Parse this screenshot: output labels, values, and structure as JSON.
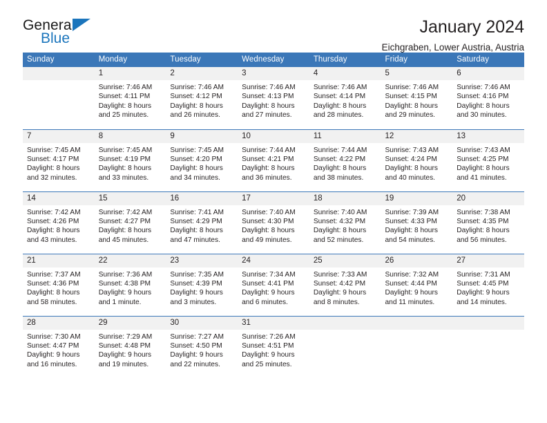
{
  "brand": {
    "name_top": "General",
    "name_bottom": "Blue",
    "accent_color": "#1b75bc"
  },
  "header": {
    "title": "January 2024",
    "subtitle": "Eichgraben, Lower Austria, Austria"
  },
  "theme": {
    "header_row_bg": "#3b77b8",
    "header_row_text": "#ffffff",
    "daynum_bg": "#f1f1f1",
    "separator": "#3b77b8",
    "body_text": "#231f20"
  },
  "weekdays": [
    "Sunday",
    "Monday",
    "Tuesday",
    "Wednesday",
    "Thursday",
    "Friday",
    "Saturday"
  ],
  "weeks": [
    [
      {
        "day": "",
        "lines": []
      },
      {
        "day": "1",
        "lines": [
          "Sunrise: 7:46 AM",
          "Sunset: 4:11 PM",
          "Daylight: 8 hours",
          "and 25 minutes."
        ]
      },
      {
        "day": "2",
        "lines": [
          "Sunrise: 7:46 AM",
          "Sunset: 4:12 PM",
          "Daylight: 8 hours",
          "and 26 minutes."
        ]
      },
      {
        "day": "3",
        "lines": [
          "Sunrise: 7:46 AM",
          "Sunset: 4:13 PM",
          "Daylight: 8 hours",
          "and 27 minutes."
        ]
      },
      {
        "day": "4",
        "lines": [
          "Sunrise: 7:46 AM",
          "Sunset: 4:14 PM",
          "Daylight: 8 hours",
          "and 28 minutes."
        ]
      },
      {
        "day": "5",
        "lines": [
          "Sunrise: 7:46 AM",
          "Sunset: 4:15 PM",
          "Daylight: 8 hours",
          "and 29 minutes."
        ]
      },
      {
        "day": "6",
        "lines": [
          "Sunrise: 7:46 AM",
          "Sunset: 4:16 PM",
          "Daylight: 8 hours",
          "and 30 minutes."
        ]
      }
    ],
    [
      {
        "day": "7",
        "lines": [
          "Sunrise: 7:45 AM",
          "Sunset: 4:17 PM",
          "Daylight: 8 hours",
          "and 32 minutes."
        ]
      },
      {
        "day": "8",
        "lines": [
          "Sunrise: 7:45 AM",
          "Sunset: 4:19 PM",
          "Daylight: 8 hours",
          "and 33 minutes."
        ]
      },
      {
        "day": "9",
        "lines": [
          "Sunrise: 7:45 AM",
          "Sunset: 4:20 PM",
          "Daylight: 8 hours",
          "and 34 minutes."
        ]
      },
      {
        "day": "10",
        "lines": [
          "Sunrise: 7:44 AM",
          "Sunset: 4:21 PM",
          "Daylight: 8 hours",
          "and 36 minutes."
        ]
      },
      {
        "day": "11",
        "lines": [
          "Sunrise: 7:44 AM",
          "Sunset: 4:22 PM",
          "Daylight: 8 hours",
          "and 38 minutes."
        ]
      },
      {
        "day": "12",
        "lines": [
          "Sunrise: 7:43 AM",
          "Sunset: 4:24 PM",
          "Daylight: 8 hours",
          "and 40 minutes."
        ]
      },
      {
        "day": "13",
        "lines": [
          "Sunrise: 7:43 AM",
          "Sunset: 4:25 PM",
          "Daylight: 8 hours",
          "and 41 minutes."
        ]
      }
    ],
    [
      {
        "day": "14",
        "lines": [
          "Sunrise: 7:42 AM",
          "Sunset: 4:26 PM",
          "Daylight: 8 hours",
          "and 43 minutes."
        ]
      },
      {
        "day": "15",
        "lines": [
          "Sunrise: 7:42 AM",
          "Sunset: 4:27 PM",
          "Daylight: 8 hours",
          "and 45 minutes."
        ]
      },
      {
        "day": "16",
        "lines": [
          "Sunrise: 7:41 AM",
          "Sunset: 4:29 PM",
          "Daylight: 8 hours",
          "and 47 minutes."
        ]
      },
      {
        "day": "17",
        "lines": [
          "Sunrise: 7:40 AM",
          "Sunset: 4:30 PM",
          "Daylight: 8 hours",
          "and 49 minutes."
        ]
      },
      {
        "day": "18",
        "lines": [
          "Sunrise: 7:40 AM",
          "Sunset: 4:32 PM",
          "Daylight: 8 hours",
          "and 52 minutes."
        ]
      },
      {
        "day": "19",
        "lines": [
          "Sunrise: 7:39 AM",
          "Sunset: 4:33 PM",
          "Daylight: 8 hours",
          "and 54 minutes."
        ]
      },
      {
        "day": "20",
        "lines": [
          "Sunrise: 7:38 AM",
          "Sunset: 4:35 PM",
          "Daylight: 8 hours",
          "and 56 minutes."
        ]
      }
    ],
    [
      {
        "day": "21",
        "lines": [
          "Sunrise: 7:37 AM",
          "Sunset: 4:36 PM",
          "Daylight: 8 hours",
          "and 58 minutes."
        ]
      },
      {
        "day": "22",
        "lines": [
          "Sunrise: 7:36 AM",
          "Sunset: 4:38 PM",
          "Daylight: 9 hours",
          "and 1 minute."
        ]
      },
      {
        "day": "23",
        "lines": [
          "Sunrise: 7:35 AM",
          "Sunset: 4:39 PM",
          "Daylight: 9 hours",
          "and 3 minutes."
        ]
      },
      {
        "day": "24",
        "lines": [
          "Sunrise: 7:34 AM",
          "Sunset: 4:41 PM",
          "Daylight: 9 hours",
          "and 6 minutes."
        ]
      },
      {
        "day": "25",
        "lines": [
          "Sunrise: 7:33 AM",
          "Sunset: 4:42 PM",
          "Daylight: 9 hours",
          "and 8 minutes."
        ]
      },
      {
        "day": "26",
        "lines": [
          "Sunrise: 7:32 AM",
          "Sunset: 4:44 PM",
          "Daylight: 9 hours",
          "and 11 minutes."
        ]
      },
      {
        "day": "27",
        "lines": [
          "Sunrise: 7:31 AM",
          "Sunset: 4:45 PM",
          "Daylight: 9 hours",
          "and 14 minutes."
        ]
      }
    ],
    [
      {
        "day": "28",
        "lines": [
          "Sunrise: 7:30 AM",
          "Sunset: 4:47 PM",
          "Daylight: 9 hours",
          "and 16 minutes."
        ]
      },
      {
        "day": "29",
        "lines": [
          "Sunrise: 7:29 AM",
          "Sunset: 4:48 PM",
          "Daylight: 9 hours",
          "and 19 minutes."
        ]
      },
      {
        "day": "30",
        "lines": [
          "Sunrise: 7:27 AM",
          "Sunset: 4:50 PM",
          "Daylight: 9 hours",
          "and 22 minutes."
        ]
      },
      {
        "day": "31",
        "lines": [
          "Sunrise: 7:26 AM",
          "Sunset: 4:51 PM",
          "Daylight: 9 hours",
          "and 25 minutes."
        ]
      },
      {
        "day": "",
        "lines": []
      },
      {
        "day": "",
        "lines": []
      },
      {
        "day": "",
        "lines": []
      }
    ]
  ]
}
